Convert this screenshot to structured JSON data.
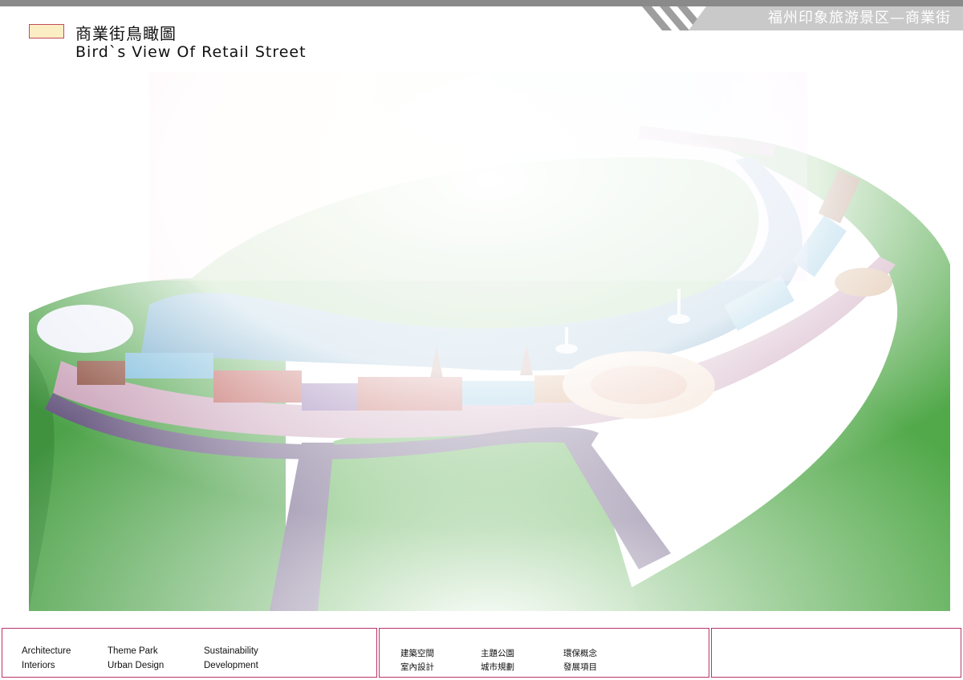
{
  "header": {
    "project_title": "福州印象旅游景区—商業街"
  },
  "title": {
    "cn": "商業街鳥瞰圖",
    "en": "Bird`s View Of Retail Street"
  },
  "footer": {
    "en": {
      "row1": [
        "Architecture",
        "Theme Park",
        "Sustainability"
      ],
      "row2": [
        "Interiors",
        "Urban Design",
        "Development"
      ]
    },
    "cn": {
      "row1": [
        "建築空間",
        "主題公園",
        "環保概念"
      ],
      "row2": [
        "室內設計",
        "城市規劃",
        "發展項目"
      ]
    }
  },
  "colors": {
    "accent_border": "#b9346a",
    "header_gray": "#8a8a8a",
    "swatch_fill": "#fbedc4"
  }
}
